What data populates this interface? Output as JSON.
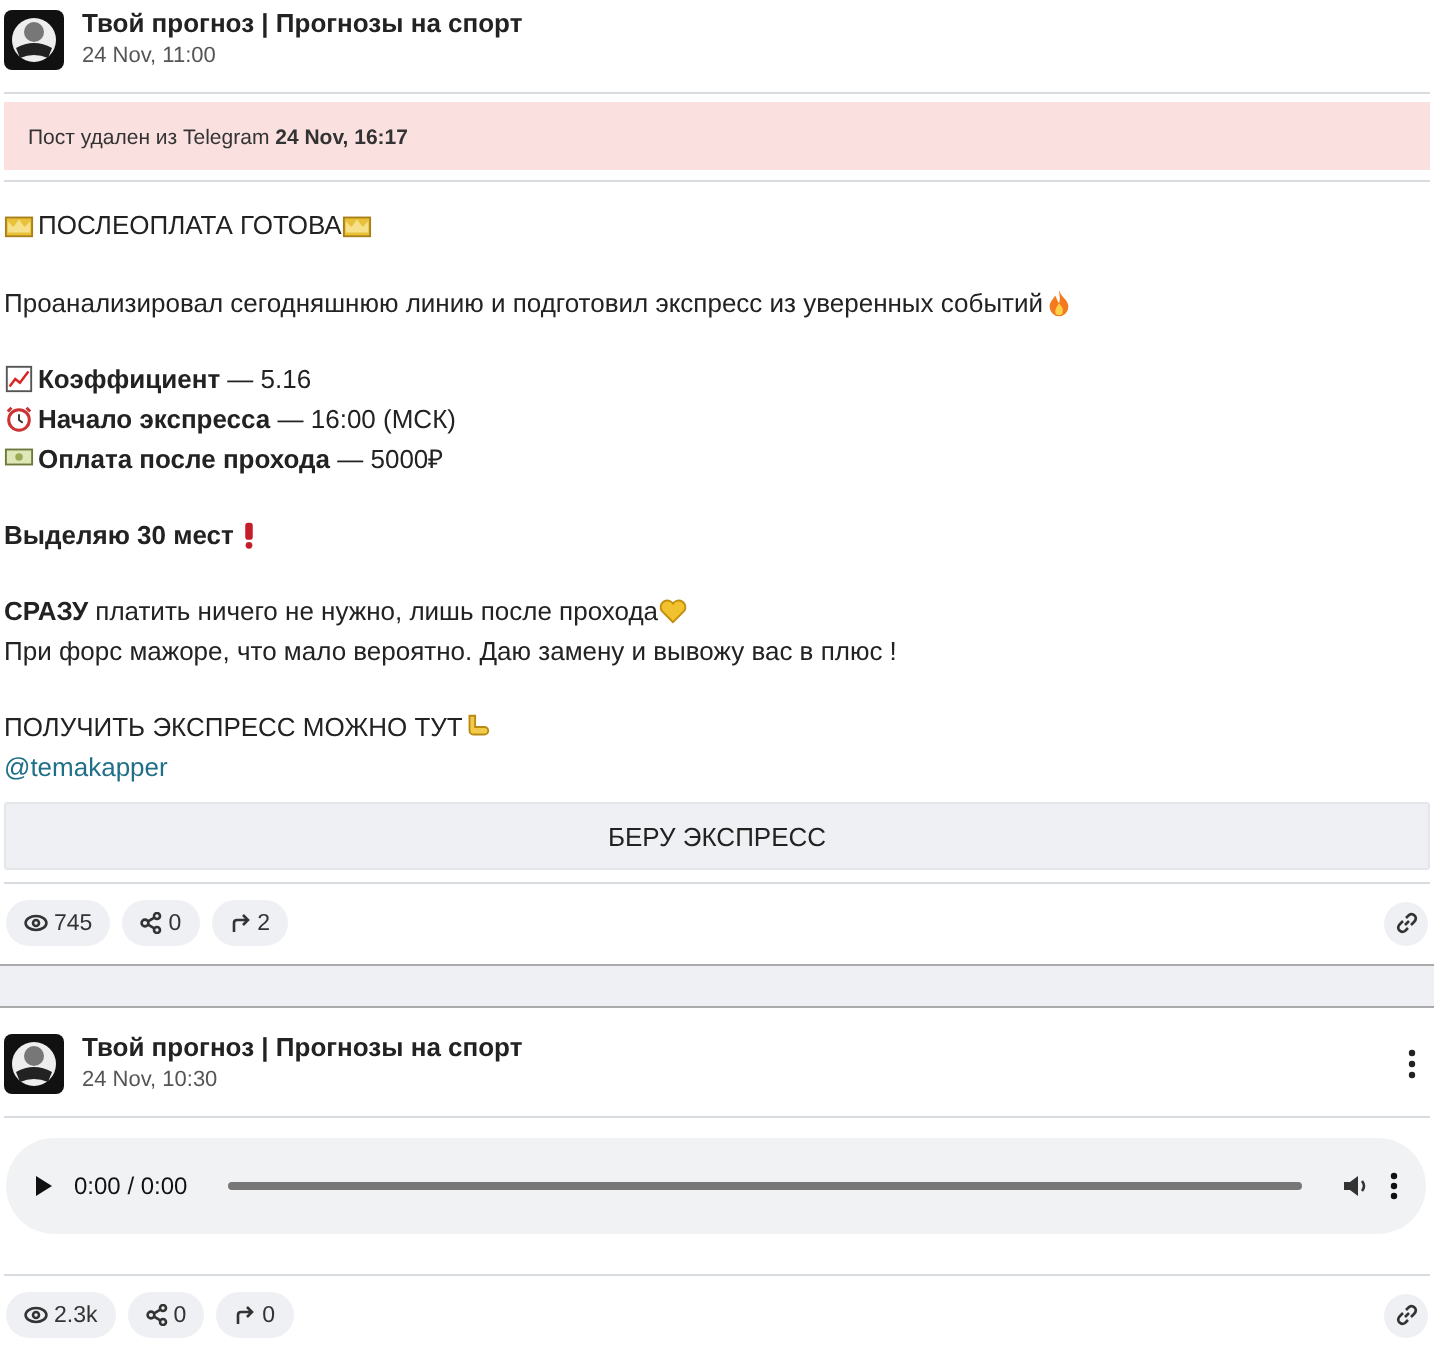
{
  "posts": [
    {
      "channel": "Твой прогноз | Прогнозы на спорт",
      "date": "24 Nov, 11:00",
      "menu": false,
      "deleted_notice": {
        "text": "Пост удален из Telegram",
        "date": "24 Nov, 16:17"
      },
      "body": [
        [
          [
            {
              "kind": "crown"
            },
            {
              "kind": "text",
              "text": "ПОСЛЕОПЛАТА ГОТОВА",
              "bold": false
            },
            {
              "kind": "crown"
            }
          ]
        ],
        [
          [
            {
              "kind": "text",
              "text": "Проанализировал сегодняшнюю линию и подготовил экспресс из уверенных событий",
              "bold": false
            },
            {
              "kind": "fire"
            }
          ]
        ],
        [
          [
            {
              "kind": "chart"
            },
            {
              "kind": "text",
              "text": "**Коэффициент** — 5.16",
              "bold": false
            }
          ],
          [
            {
              "kind": "clock"
            },
            {
              "kind": "text",
              "text": "**Начало экспресса** — 16:00 (МСК)",
              "bold": false
            }
          ],
          [
            {
              "kind": "money"
            },
            {
              "kind": "text",
              "text": "**Оплата после прохода** — 5000₽",
              "bold": false
            }
          ]
        ],
        [
          [
            {
              "kind": "text",
              "text": "Выделяю 30 мест",
              "bold": true
            },
            {
              "kind": "exclamation"
            }
          ]
        ],
        [
          [
            {
              "kind": "text",
              "text": "**СРАЗУ** платить ничего не нужно, лишь после прохода",
              "bold": false
            },
            {
              "kind": "heart"
            }
          ],
          [
            {
              "kind": "text",
              "text": "При форс мажоре, что мало вероятно. Даю замену и вывожу вас в плюс !",
              "bold": false
            }
          ]
        ],
        [
          [
            {
              "kind": "text",
              "text": "ПОЛУЧИТЬ ЭКСПРЕСС МОЖНО ТУТ",
              "bold": false
            },
            {
              "kind": "hand"
            }
          ],
          [
            {
              "kind": "link",
              "text": "@temakapper"
            }
          ]
        ]
      ],
      "button": "БЕРУ ЭКСПРЕСС",
      "stats": {
        "views": "745",
        "shares": "0",
        "forwards": "2"
      }
    },
    {
      "channel": "Твой прогноз | Прогнозы на спорт",
      "date": "24 Nov, 10:30",
      "menu": true,
      "audio": {
        "time": "0:00 / 0:00",
        "level": 0
      },
      "stats": {
        "views": "2.3k",
        "shares": "0",
        "forwards": "0"
      }
    }
  ]
}
